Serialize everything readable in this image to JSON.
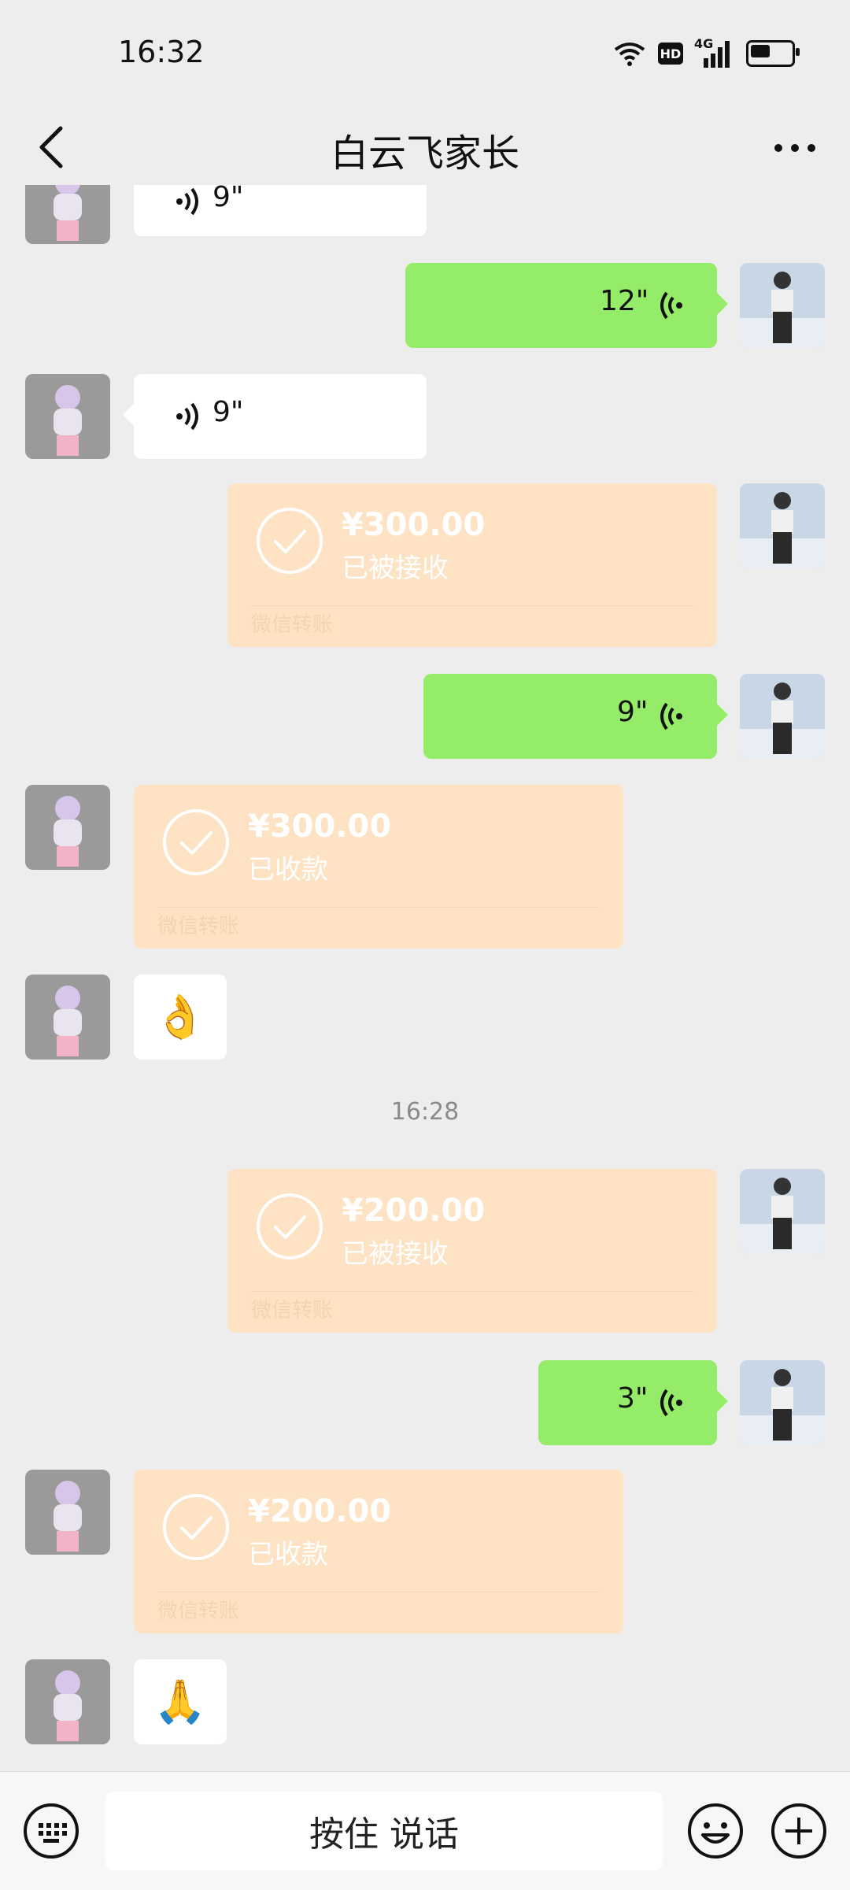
{
  "status_bar": {
    "time": "16:32",
    "icons": [
      "wifi-icon",
      "hd-icon",
      "4g-signal-icon",
      "battery-icon"
    ],
    "hd_label": "HD",
    "network_label": "4G"
  },
  "header": {
    "title": "白云飞家长",
    "back_icon": "chevron-left-icon",
    "more_icon": "more-dots-icon"
  },
  "messages": {
    "m1": {
      "sender": "other",
      "type": "voice",
      "duration": "9\""
    },
    "m2": {
      "sender": "me",
      "type": "voice",
      "duration": "12\""
    },
    "m3": {
      "sender": "other",
      "type": "voice",
      "duration": "9\""
    },
    "m4": {
      "sender": "me",
      "type": "transfer",
      "amount": "¥300.00",
      "status": "已被接收",
      "footer": "微信转账"
    },
    "m5": {
      "sender": "me",
      "type": "voice",
      "duration": "9\""
    },
    "m6": {
      "sender": "other",
      "type": "transfer",
      "amount": "¥300.00",
      "status": "已收款",
      "footer": "微信转账"
    },
    "m7": {
      "sender": "other",
      "type": "emoji",
      "emoji": "👌"
    },
    "ts1": {
      "type": "timestamp",
      "text": "16:28"
    },
    "m8": {
      "sender": "me",
      "type": "transfer",
      "amount": "¥200.00",
      "status": "已被接收",
      "footer": "微信转账"
    },
    "m9": {
      "sender": "me",
      "type": "voice",
      "duration": "3\""
    },
    "m10": {
      "sender": "other",
      "type": "transfer",
      "amount": "¥200.00",
      "status": "已收款",
      "footer": "微信转账"
    },
    "m11": {
      "sender": "other",
      "type": "emoji",
      "emoji": "🙏"
    }
  },
  "input_bar": {
    "talk_label": "按住 说话",
    "icons": [
      "keyboard-icon",
      "emoji-face-icon",
      "plus-icon"
    ]
  },
  "colors": {
    "background": "#ededed",
    "my_bubble": "#95ec69",
    "other_bubble": "#ffffff",
    "transfer_bubble": "#fde3c4"
  }
}
